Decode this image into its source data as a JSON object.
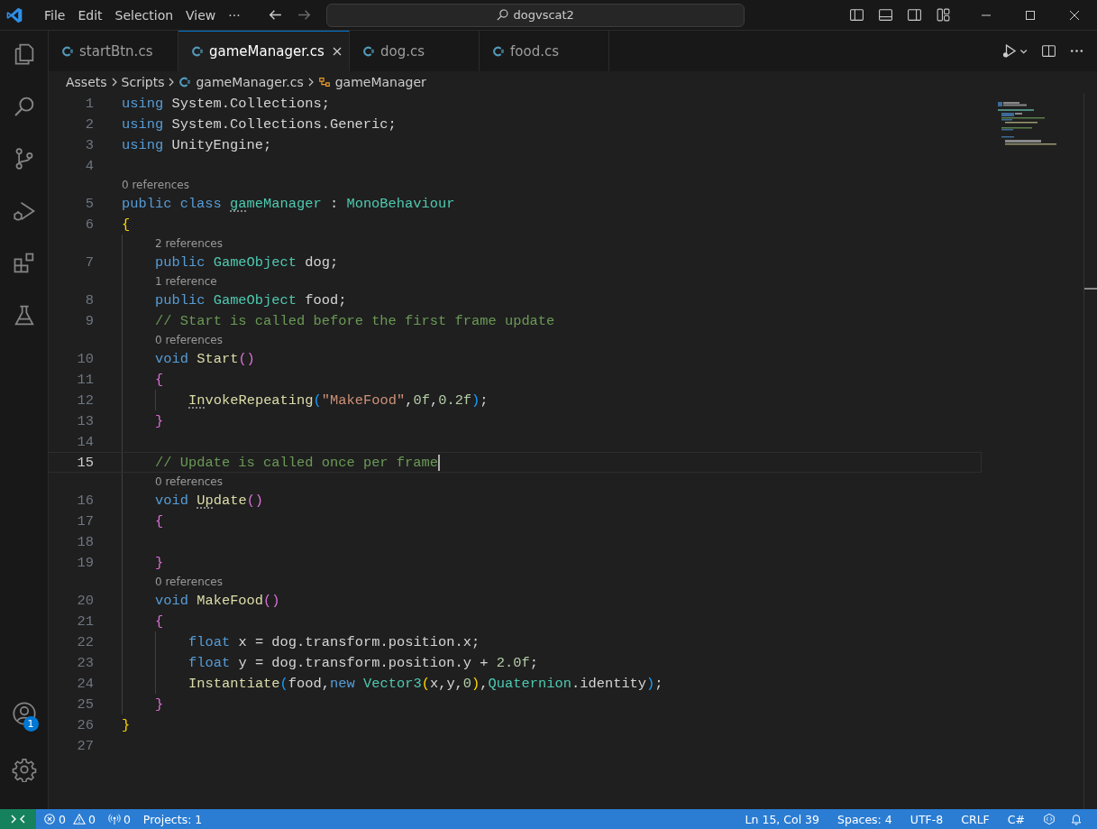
{
  "menu": [
    "File",
    "Edit",
    "Selection",
    "View",
    "···"
  ],
  "command_center": "dogvscat2",
  "tabs": [
    {
      "label": "startBtn.cs",
      "selected": false
    },
    {
      "label": "gameManager.cs",
      "selected": true
    },
    {
      "label": "dog.cs",
      "selected": false
    },
    {
      "label": "food.cs",
      "selected": false
    }
  ],
  "breadcrumbs": [
    {
      "label": "Assets",
      "kind": "folder"
    },
    {
      "label": "Scripts",
      "kind": "folder"
    },
    {
      "label": "gameManager.cs",
      "kind": "file"
    },
    {
      "label": "gameManager",
      "kind": "class"
    }
  ],
  "lines": [
    {
      "number": "1",
      "tokens": [
        {
          "kind": "kw",
          "text": "using"
        },
        {
          "kind": "plain",
          "text": " System.Collections;"
        }
      ]
    },
    {
      "number": "2",
      "tokens": [
        {
          "kind": "kw",
          "text": "using"
        },
        {
          "kind": "plain",
          "text": " System.Collections.Generic;"
        }
      ]
    },
    {
      "number": "3",
      "tokens": [
        {
          "kind": "kw",
          "text": "using"
        },
        {
          "kind": "plain",
          "text": " UnityEngine;"
        }
      ]
    },
    {
      "number": "4"
    },
    {
      "number": "5",
      "lens": "0 references",
      "tokens": [
        {
          "kind": "kw",
          "text": "public class "
        },
        {
          "kind": "type",
          "text": "ga",
          "hint": true
        },
        {
          "kind": "type",
          "text": "meManager"
        },
        {
          "kind": "plain",
          "text": " : "
        },
        {
          "kind": "type",
          "text": "MonoBehaviour"
        }
      ]
    },
    {
      "number": "6",
      "tokens": [
        {
          "kind": "b1",
          "text": "{"
        }
      ]
    },
    {
      "number": "7",
      "lens": "2 references",
      "tokens": [
        {
          "kind": "kw",
          "text": "    public "
        },
        {
          "kind": "type",
          "text": "GameObject"
        },
        {
          "kind": "plain",
          "text": " dog;"
        }
      ]
    },
    {
      "number": "8",
      "lens": "1 reference",
      "tokens": [
        {
          "kind": "kw",
          "text": "    public "
        },
        {
          "kind": "type",
          "text": "GameObject"
        },
        {
          "kind": "plain",
          "text": " food;"
        }
      ]
    },
    {
      "number": "9",
      "tokens": [
        {
          "kind": "cmt",
          "text": "    // Start is called before the first frame update"
        }
      ]
    },
    {
      "number": "10",
      "lens": "0 references",
      "tokens": [
        {
          "kind": "kw",
          "text": "    void "
        },
        {
          "kind": "fn",
          "text": "Start"
        },
        {
          "kind": "b2",
          "text": "()"
        }
      ]
    },
    {
      "number": "11",
      "tokens": [
        {
          "kind": "b2",
          "text": "    {"
        }
      ]
    },
    {
      "number": "12",
      "tokens": [
        {
          "kind": "fn",
          "text": "        In",
          "hint": true
        },
        {
          "kind": "fn",
          "text": "vokeRepeating"
        },
        {
          "kind": "b3",
          "text": "("
        },
        {
          "kind": "str",
          "text": "\"MakeFood\""
        },
        {
          "kind": "plain",
          "text": ","
        },
        {
          "kind": "num",
          "text": "0f"
        },
        {
          "kind": "plain",
          "text": ","
        },
        {
          "kind": "num",
          "text": "0.2f"
        },
        {
          "kind": "b3",
          "text": ")"
        },
        {
          "kind": "plain",
          "text": ";"
        }
      ]
    },
    {
      "number": "13",
      "tokens": [
        {
          "kind": "b2",
          "text": "    }"
        }
      ]
    },
    {
      "number": "14"
    },
    {
      "number": "15",
      "current": true,
      "tokens": [
        {
          "kind": "cmt",
          "text": "    // Update is called once per frame"
        }
      ]
    },
    {
      "number": "16",
      "lens": "0 references",
      "tokens": [
        {
          "kind": "kw",
          "text": "    void "
        },
        {
          "kind": "fn",
          "text": "Up",
          "hint": true
        },
        {
          "kind": "fn",
          "text": "date"
        },
        {
          "kind": "b2",
          "text": "()"
        }
      ]
    },
    {
      "number": "17",
      "tokens": [
        {
          "kind": "b2",
          "text": "    {"
        }
      ]
    },
    {
      "number": "18"
    },
    {
      "number": "19",
      "tokens": [
        {
          "kind": "b2",
          "text": "    }"
        }
      ]
    },
    {
      "number": "20",
      "lens": "0 references",
      "tokens": [
        {
          "kind": "kw",
          "text": "    void "
        },
        {
          "kind": "fn",
          "text": "MakeFood"
        },
        {
          "kind": "b2",
          "text": "()"
        }
      ]
    },
    {
      "number": "21",
      "tokens": [
        {
          "kind": "b2",
          "text": "    {"
        }
      ]
    },
    {
      "number": "22",
      "tokens": [
        {
          "kind": "kw",
          "text": "        float"
        },
        {
          "kind": "plain",
          "text": " x = dog.transform.position.x;"
        }
      ]
    },
    {
      "number": "23",
      "tokens": [
        {
          "kind": "kw",
          "text": "        float"
        },
        {
          "kind": "plain",
          "text": " y = dog.transform.position.y + "
        },
        {
          "kind": "num",
          "text": "2.0f"
        },
        {
          "kind": "plain",
          "text": ";"
        }
      ]
    },
    {
      "number": "24",
      "tokens": [
        {
          "kind": "fn",
          "text": "        Instantiate"
        },
        {
          "kind": "b3",
          "text": "("
        },
        {
          "kind": "plain",
          "text": "food,"
        },
        {
          "kind": "kw",
          "text": "new "
        },
        {
          "kind": "type",
          "text": "Vector3"
        },
        {
          "kind": "b1",
          "text": "("
        },
        {
          "kind": "plain",
          "text": "x,y,"
        },
        {
          "kind": "num",
          "text": "0"
        },
        {
          "kind": "b1",
          "text": ")"
        },
        {
          "kind": "plain",
          "text": ","
        },
        {
          "kind": "type",
          "text": "Quaternion"
        },
        {
          "kind": "plain",
          "text": ".identity"
        },
        {
          "kind": "b3",
          "text": ")"
        },
        {
          "kind": "plain",
          "text": ";"
        }
      ]
    },
    {
      "number": "25",
      "tokens": [
        {
          "kind": "b2",
          "text": "    }"
        }
      ]
    },
    {
      "number": "26",
      "tokens": [
        {
          "kind": "b1",
          "text": "}"
        }
      ]
    },
    {
      "number": "27"
    }
  ],
  "account_badge": "1",
  "status_left": [
    {
      "kind": "errors",
      "text": "0"
    },
    {
      "kind": "warnings",
      "text": "0"
    },
    {
      "kind": "ports",
      "text": "0"
    },
    {
      "kind": "text",
      "text": "Projects: 1"
    }
  ],
  "status_right": [
    "Ln 15, Col 39",
    "Spaces: 4",
    "UTF-8",
    "CRLF",
    "C#"
  ]
}
